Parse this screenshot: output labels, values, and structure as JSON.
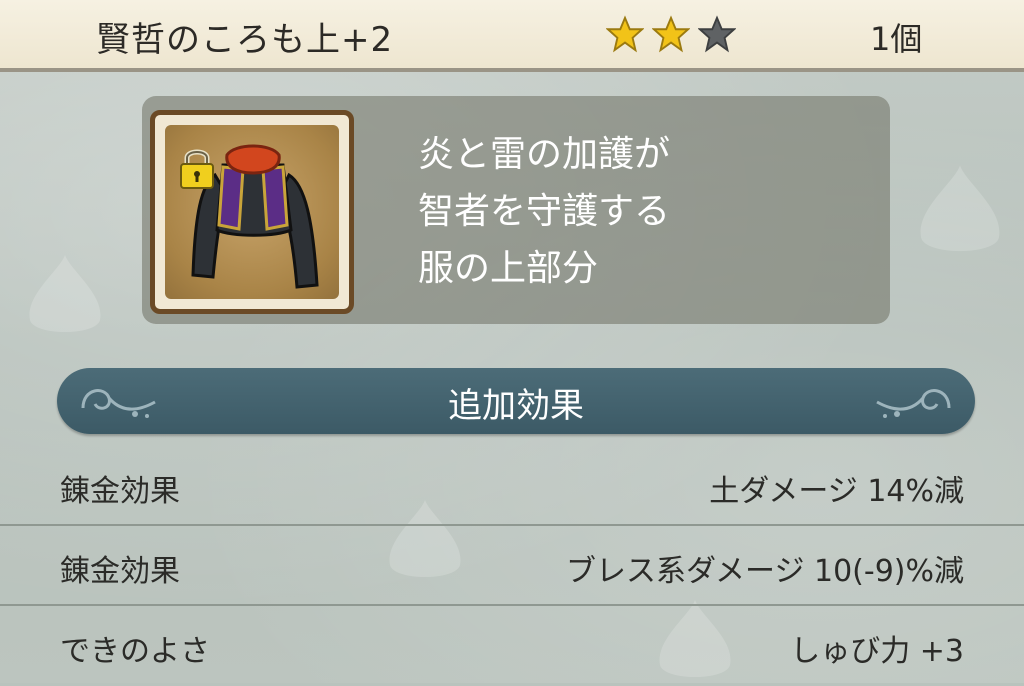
{
  "header": {
    "item_name": "賢哲のころも上+2",
    "rating": 2,
    "rating_max": 3,
    "count": "1個"
  },
  "item": {
    "icon": "robe-top-icon",
    "locked": true,
    "description": [
      "炎と雷の加護が",
      "智者を守護する",
      "服の上部分"
    ]
  },
  "section": {
    "title": "追加効果"
  },
  "effects": [
    {
      "label": "錬金効果",
      "value": "土ダメージ 14%減"
    },
    {
      "label": "錬金効果",
      "value": "ブレス系ダメージ 10(-9)%減"
    },
    {
      "label": "できのよさ",
      "value": "しゅび力 +3"
    }
  ],
  "colors": {
    "star_filled": "#f2c318",
    "star_empty": "#5f6264",
    "banner": "#45636f",
    "header_bg": "#f3eddc"
  }
}
